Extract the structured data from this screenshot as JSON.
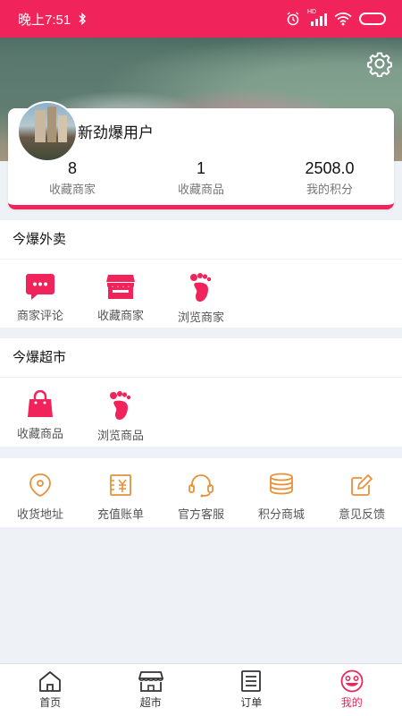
{
  "status_bar": {
    "time": "晚上7:51",
    "network": "HD"
  },
  "profile": {
    "username": "新劲爆用户",
    "stats": [
      {
        "value": "8",
        "label": "收藏商家"
      },
      {
        "value": "1",
        "label": "收藏商品"
      },
      {
        "value": "2508.0",
        "label": "我的积分"
      }
    ]
  },
  "takeout": {
    "title": "今爆外卖",
    "items": [
      {
        "label": "商家评论",
        "icon": "chat-bubble-icon"
      },
      {
        "label": "收藏商家",
        "icon": "shop-icon"
      },
      {
        "label": "浏览商家",
        "icon": "footprint-icon"
      }
    ]
  },
  "market": {
    "title": "今爆超市",
    "items": [
      {
        "label": "收藏商品",
        "icon": "shopping-bag-icon"
      },
      {
        "label": "浏览商品",
        "icon": "footprint-icon"
      }
    ]
  },
  "tools": {
    "items": [
      {
        "label": "收货地址",
        "icon": "location-icon"
      },
      {
        "label": "充值账单",
        "icon": "bill-icon"
      },
      {
        "label": "官方客服",
        "icon": "headset-icon"
      },
      {
        "label": "积分商城",
        "icon": "coins-icon"
      },
      {
        "label": "意见反馈",
        "icon": "feedback-icon"
      }
    ]
  },
  "bottom_nav": [
    {
      "label": "首页",
      "icon": "home-icon",
      "active": false
    },
    {
      "label": "超市",
      "icon": "store-icon",
      "active": false
    },
    {
      "label": "订单",
      "icon": "order-list-icon",
      "active": false
    },
    {
      "label": "我的",
      "icon": "smiley-icon",
      "active": true
    }
  ],
  "colors": {
    "accent": "#f0245a",
    "tool_orange": "#e8913a",
    "background": "#eef1f5"
  }
}
